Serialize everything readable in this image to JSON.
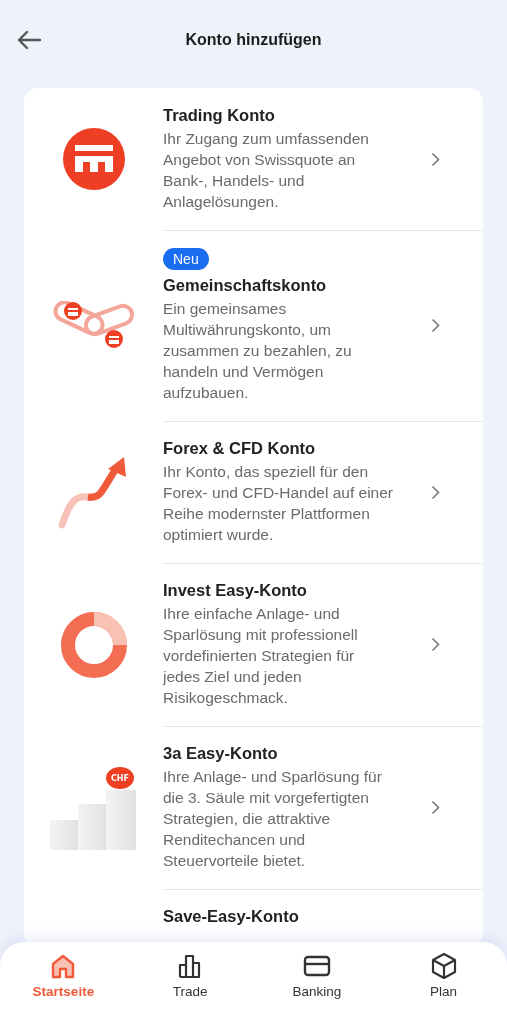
{
  "header": {
    "title": "Konto hinzufügen"
  },
  "accounts": [
    {
      "kind": "emblem",
      "title": "Trading Konto",
      "description": "Ihr Zugang zum umfassenden Angebot von Swissquote an Bank-, Handels- und Anlagelösungen."
    },
    {
      "kind": "chain",
      "badge": "Neu",
      "title": "Gemeinschaftskonto",
      "description": "Ein gemeinsames Multiwährungskonto, um zusammen zu bezahlen, zu handeln und Vermögen aufzubauen."
    },
    {
      "kind": "arrow",
      "title": "Forex & CFD Konto",
      "description": "Ihr Konto, das speziell für den Forex- und CFD-Handel auf einer Reihe modernster Plattformen optimiert wurde."
    },
    {
      "kind": "ring",
      "title": "Invest Easy-Konto",
      "description": "Ihre einfache Anlage- und Sparlösung mit professionell vordefinierten Strategien für jedes Ziel und jeden Risikogeschmack."
    },
    {
      "kind": "steps",
      "coin": "CHF",
      "title": "3a Easy-Konto",
      "description": "Ihre Anlage- und Sparlösung für die 3. Säule mit vorgefertigten Strategien, die attraktive Renditechancen und Steuervorteile bietet."
    },
    {
      "kind": "none",
      "title": "Save-Easy-Konto"
    }
  ],
  "nav": [
    {
      "kind": "home",
      "label": "Startseite",
      "selected": true
    },
    {
      "kind": "chart",
      "label": "Trade",
      "selected": false
    },
    {
      "kind": "card",
      "label": "Banking",
      "selected": false
    },
    {
      "kind": "cube",
      "label": "Plan",
      "selected": false
    }
  ]
}
